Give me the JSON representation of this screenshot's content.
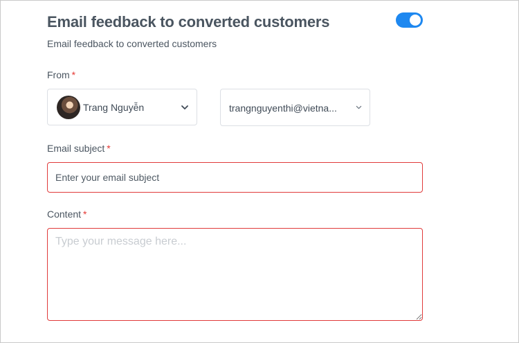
{
  "header": {
    "title": "Email feedback to converted customers",
    "subtitle": "Email feedback to converted customers",
    "toggle_on": true
  },
  "from": {
    "label": "From",
    "required_mark": "*",
    "sender_name": "Trang Nguyễn",
    "sender_email": "trangnguyenthi@vietna..."
  },
  "subject": {
    "label": "Email subject",
    "required_mark": "*",
    "placeholder": "Enter your email subject",
    "value": ""
  },
  "content": {
    "label": "Content",
    "required_mark": "*",
    "placeholder": "Type your message here...",
    "value": ""
  },
  "colors": {
    "accent": "#1e88f0",
    "required": "#e53935",
    "error_border": "#e03a3a"
  }
}
